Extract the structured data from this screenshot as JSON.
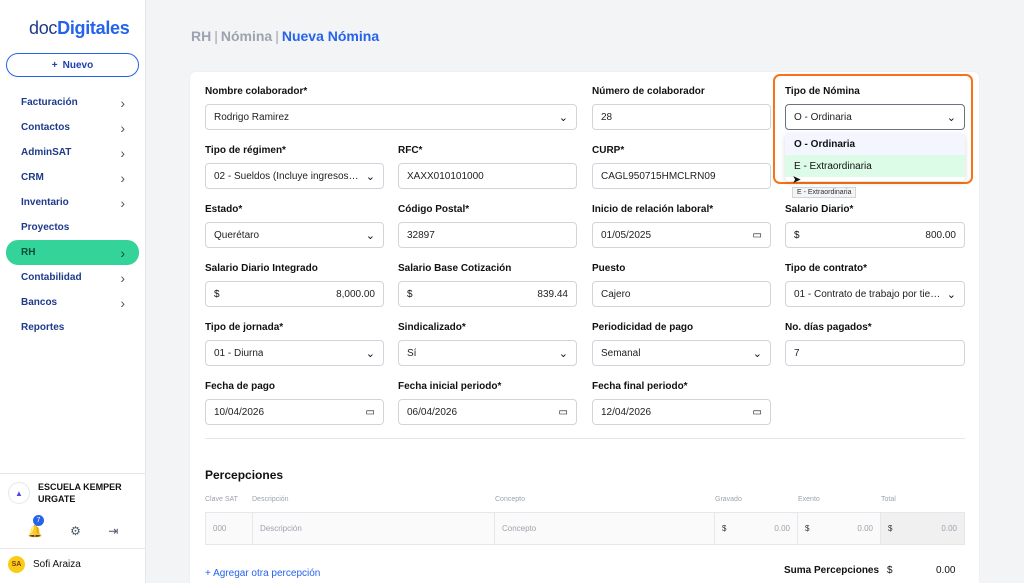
{
  "logo": {
    "part1": "doc",
    "part2": "Digitales"
  },
  "new_button": {
    "icon": "plus-icon",
    "label": "Nuevo"
  },
  "nav": [
    {
      "label": "Facturación",
      "chevron": true
    },
    {
      "label": "Contactos",
      "chevron": true
    },
    {
      "label": "AdminSAT",
      "chevron": true
    },
    {
      "label": "CRM",
      "chevron": true
    },
    {
      "label": "Inventario",
      "chevron": true
    },
    {
      "label": "Proyectos",
      "chevron": false
    },
    {
      "label": "RH",
      "chevron": true,
      "active": true
    },
    {
      "label": "Contabilidad",
      "chevron": true
    },
    {
      "label": "Bancos",
      "chevron": true
    },
    {
      "label": "Reportes",
      "chevron": false
    }
  ],
  "org": {
    "name_line1": "ESCUELA KEMPER",
    "name_line2": "URGATE"
  },
  "notifications": {
    "count": "7"
  },
  "user": {
    "initials": "SA",
    "name": "Sofi Araiza"
  },
  "breadcrumb": {
    "part1": "RH",
    "part2": "Nómina",
    "current": "Nueva Nómina"
  },
  "form": {
    "nombre_colaborador": {
      "label": "Nombre colaborador*",
      "value": "Rodrigo Ramirez"
    },
    "numero_colaborador": {
      "label": "Número de colaborador",
      "value": "28"
    },
    "tipo_nomina": {
      "label": "Tipo de Nómina",
      "value": "O - Ordinaria",
      "options": [
        "O - Ordinaria",
        "E - Extraordinaria"
      ],
      "tooltip": "E - Extraordinaria"
    },
    "tipo_regimen": {
      "label": "Tipo de régimen*",
      "value": "02 - Sueldos (Incluye ingresos se..."
    },
    "rfc": {
      "label": "RFC*",
      "value": "XAXX010101000"
    },
    "curp": {
      "label": "CURP*",
      "value": "CAGL950715HMCLRN09"
    },
    "estado": {
      "label": "Estado*",
      "value": "Querétaro"
    },
    "codigo_postal": {
      "label": "Código Postal*",
      "value": "32897"
    },
    "inicio_relacion": {
      "label": "Inicio de relación laboral*",
      "value": "01/05/2025"
    },
    "salario_diario": {
      "label": "Salario Diario*",
      "currency": "$",
      "value": "800.00"
    },
    "salario_diario_integrado": {
      "label": "Salario Diario Integrado",
      "currency": "$",
      "value": "8,000.00"
    },
    "salario_base_cotizacion": {
      "label": "Salario Base Cotización",
      "currency": "$",
      "value": "839.44"
    },
    "puesto": {
      "label": "Puesto",
      "value": "Cajero"
    },
    "tipo_contrato": {
      "label": "Tipo de contrato*",
      "value": "01 - Contrato de trabajo por tiem..."
    },
    "tipo_jornada": {
      "label": "Tipo de jornada*",
      "value": "01 - Diurna"
    },
    "sindicalizado": {
      "label": "Sindicalizado*",
      "value": "Sí"
    },
    "periodicidad": {
      "label": "Periodicidad de pago",
      "value": "Semanal"
    },
    "dias_pagados": {
      "label": "No. días pagados*",
      "value": "7"
    },
    "fecha_pago": {
      "label": "Fecha de pago",
      "value": "10/04/2026"
    },
    "fecha_inicial": {
      "label": "Fecha inicial periodo*",
      "value": "06/04/2026"
    },
    "fecha_final": {
      "label": "Fecha final periodo*",
      "value": "12/04/2026"
    }
  },
  "percepciones": {
    "title": "Percepciones",
    "headers": [
      "Clave SAT",
      "Descripción",
      "Concepto",
      "Gravado",
      "Exento",
      "Total"
    ],
    "row": {
      "clave_placeholder": "000",
      "descripcion_placeholder": "Descripción",
      "concepto_placeholder": "Concepto",
      "gravado_currency": "$",
      "gravado": "0.00",
      "exento_currency": "$",
      "exento": "0.00",
      "total_currency": "$",
      "total": "0.00"
    },
    "add_link": "+ Agregar otra percepción",
    "sum_label": "Suma Percepciones",
    "sum_currency": "$",
    "sum_value": "0.00"
  },
  "colors": {
    "accent": "#2563eb",
    "active_nav": "#34d399",
    "highlight": "#f97316"
  }
}
